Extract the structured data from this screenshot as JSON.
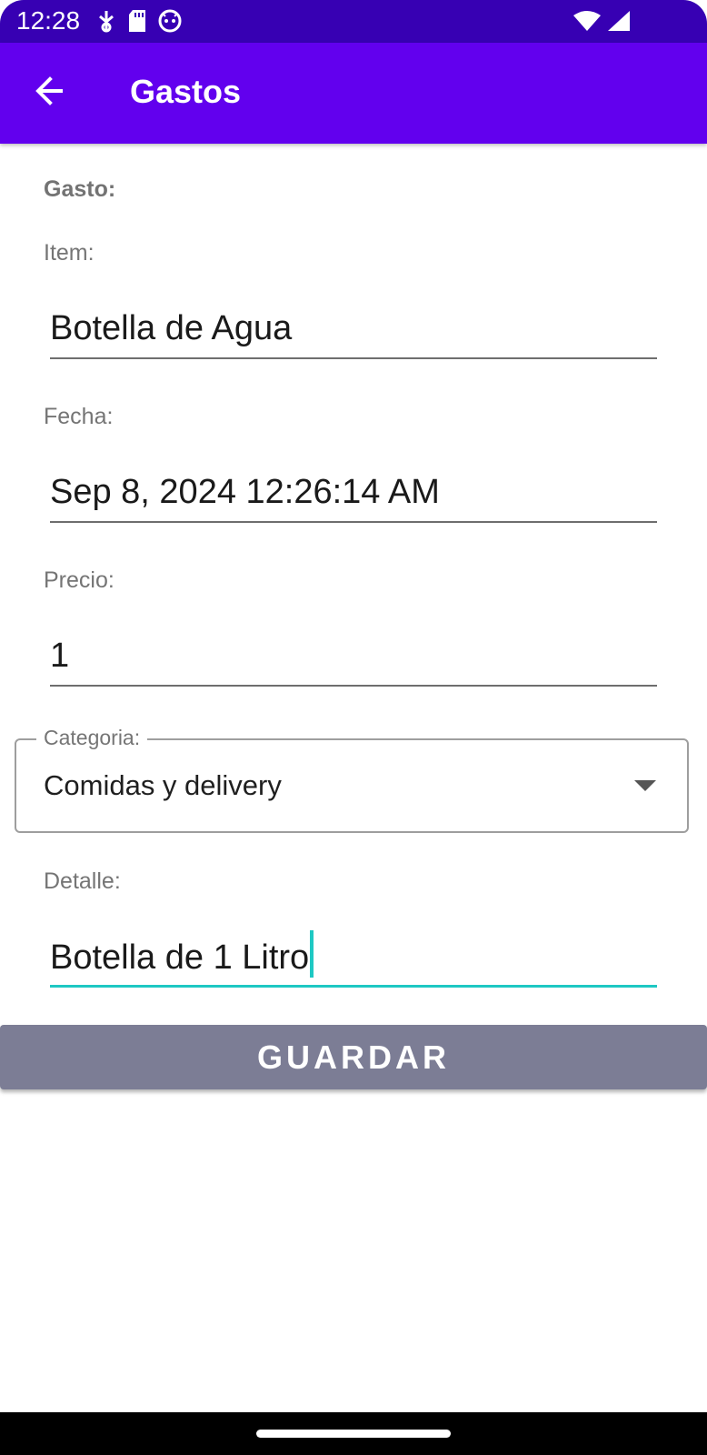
{
  "status_bar": {
    "time": "12:28",
    "left_icons": [
      "usb-debug-icon",
      "sd-card-icon",
      "android-face-icon"
    ],
    "right_icons": [
      "wifi-icon",
      "cell-signal-icon"
    ]
  },
  "app_bar": {
    "title": "Gastos",
    "back_icon": "arrow-back-icon",
    "background": "#6200ee"
  },
  "form": {
    "section_title": "Gasto:",
    "item": {
      "label": "Item:",
      "value": "Botella de Agua"
    },
    "fecha": {
      "label": "Fecha:",
      "value": "Sep 8, 2024 12:26:14 AM"
    },
    "precio": {
      "label": "Precio:",
      "value": "1"
    },
    "categoria": {
      "label": "Categoria:",
      "value": "Comidas y delivery"
    },
    "detalle": {
      "label": "Detalle:",
      "value": "Botella de 1 Litro"
    },
    "save_label": "GUARDAR"
  },
  "colors": {
    "status_bar": "#3700b3",
    "accent_focus": "#1ec8c3",
    "button": "#7c7d95"
  }
}
